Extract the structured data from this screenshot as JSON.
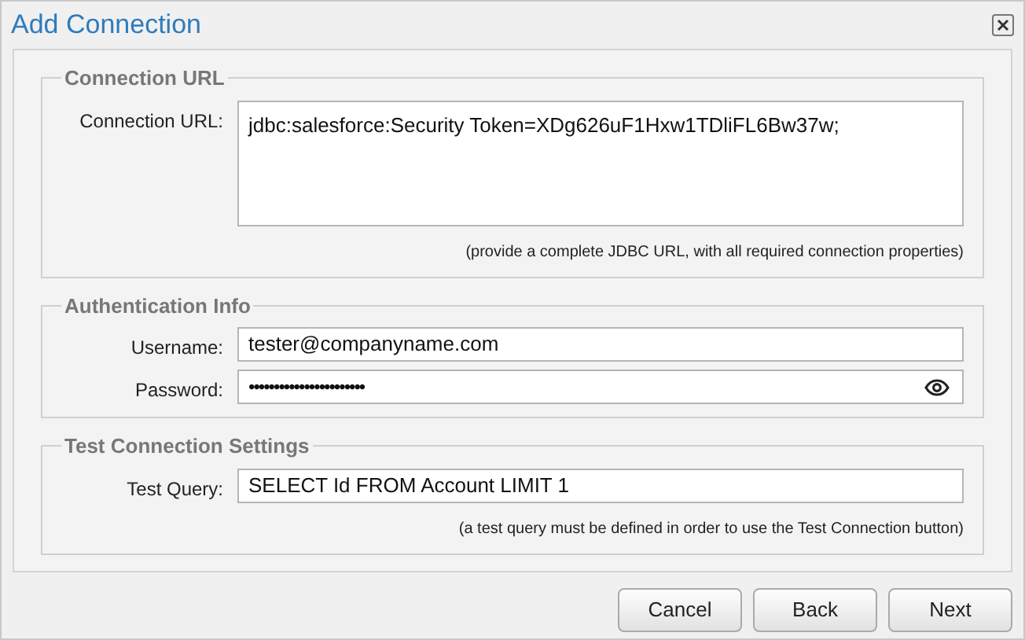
{
  "window": {
    "title": "Add Connection"
  },
  "sections": [
    {
      "legend": "Connection URL",
      "fields": [
        {
          "kind": "textarea",
          "label": "Connection URL:",
          "value": "jdbc:salesforce:Security Token=XDg626uF1Hxw1TDliFL6Bw37w;"
        }
      ],
      "hint": "(provide a complete JDBC URL, with all required connection properties)"
    },
    {
      "legend": "Authentication Info",
      "fields": [
        {
          "kind": "text",
          "label": "Username:",
          "value": "tester@companyname.com"
        },
        {
          "kind": "password",
          "label": "Password:",
          "value": "•••••••••••••••••••••••"
        }
      ]
    },
    {
      "legend": "Test Connection Settings",
      "fields": [
        {
          "kind": "text",
          "label": "Test Query:",
          "value": "SELECT Id FROM Account LIMIT 1"
        }
      ],
      "hint": "(a test query must be defined in order to use the Test Connection button)"
    }
  ],
  "buttons": [
    "Cancel",
    "Back",
    "Next"
  ]
}
